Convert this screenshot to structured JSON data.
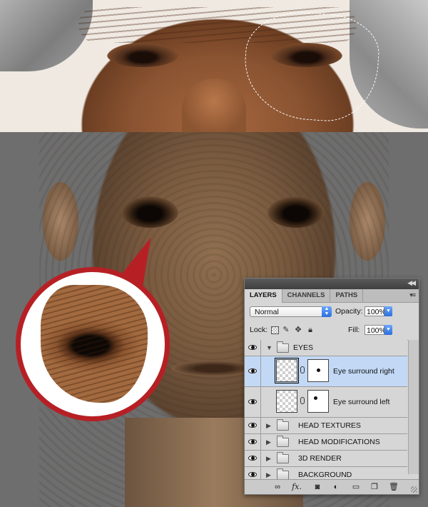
{
  "panel": {
    "tabs": [
      {
        "label": "LAYERS",
        "active": true
      },
      {
        "label": "CHANNELS",
        "active": false
      },
      {
        "label": "PATHS",
        "active": false
      }
    ],
    "blend_mode": "Normal",
    "opacity_label": "Opacity:",
    "opacity_value": "100%",
    "lock_label": "Lock:",
    "fill_label": "Fill:",
    "fill_value": "100%",
    "layers": [
      {
        "name": "EYES",
        "type": "group",
        "expanded": true
      },
      {
        "name": "Eye surround right",
        "type": "layer",
        "selected": true
      },
      {
        "name": "Eye surround left",
        "type": "layer",
        "selected": false
      },
      {
        "name": "HEAD TEXTURES",
        "type": "group",
        "expanded": false
      },
      {
        "name": "HEAD MODIFICATIONS",
        "type": "group",
        "expanded": false
      },
      {
        "name": "3D RENDER",
        "type": "group",
        "expanded": false
      },
      {
        "name": "BACKGROUND",
        "type": "group",
        "expanded": false
      }
    ],
    "footer_icons": [
      "link-layers-icon",
      "fx-icon",
      "add-mask-icon",
      "adjustment-layer-icon",
      "new-group-icon",
      "new-layer-icon",
      "trash-icon"
    ],
    "fx_glyph": "fx."
  },
  "colors": {
    "callout_red": "#b62025",
    "selection_highlight": "#c2d8f5",
    "stepper_blue": "#2d6fdc"
  }
}
